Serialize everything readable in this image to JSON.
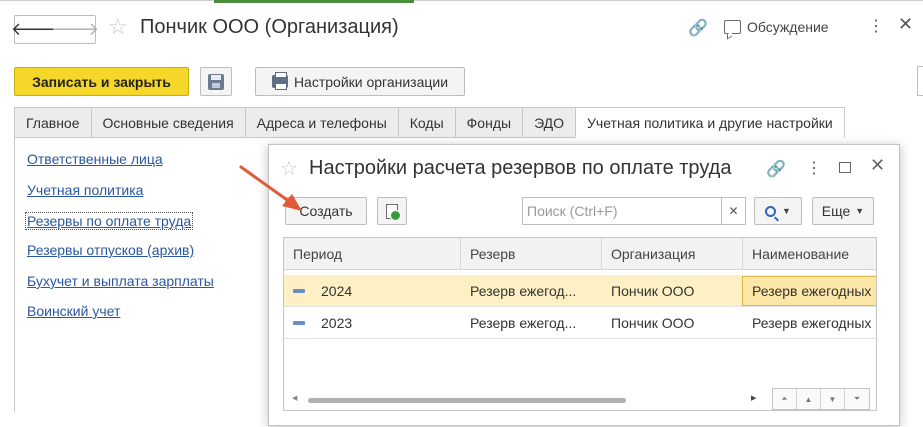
{
  "window": {
    "title": "Пончик ООО (Организация)",
    "discussion_label": "Обсуждение"
  },
  "toolbar": {
    "save_close_label": "Записать и закрыть",
    "org_settings_label": "Настройки организации"
  },
  "tabs": [
    {
      "label": "Главное"
    },
    {
      "label": "Основные сведения"
    },
    {
      "label": "Адреса и телефоны"
    },
    {
      "label": "Коды"
    },
    {
      "label": "Фонды"
    },
    {
      "label": "ЭДО"
    },
    {
      "label": "Учетная политика и другие настройки",
      "active": true
    }
  ],
  "sidebar": {
    "items": [
      {
        "label": "Ответственные лица"
      },
      {
        "label": "Учетная политика"
      },
      {
        "label": "Резервы по оплате труда",
        "active": true
      },
      {
        "label": "Резервы отпусков (архив)"
      },
      {
        "label": "Бухучет и выплата зарплаты"
      },
      {
        "label": "Воинский учет"
      }
    ]
  },
  "modal": {
    "title": "Настройки расчета резервов по оплате труда",
    "create_label": "Создать",
    "search_placeholder": "Поиск (Ctrl+F)",
    "more_label": "Еще",
    "columns": [
      "Период",
      "Резерв",
      "Организация",
      "Наименование"
    ],
    "rows": [
      {
        "period": "2024",
        "reserve": "Резерв ежегод...",
        "org": "Пончик ООО",
        "name": "Резерв ежегодных",
        "selected": true
      },
      {
        "period": "2023",
        "reserve": "Резерв ежегод...",
        "org": "Пончик ООО",
        "name": "Резерв ежегодных",
        "selected": false
      }
    ]
  },
  "icons": {
    "back": "arrow-left-icon",
    "forward": "arrow-right-icon",
    "favorite": "star-icon",
    "link": "link-icon",
    "discussion": "chat-icon",
    "more": "kebab-icon",
    "close": "close-icon",
    "save": "floppy-icon",
    "print": "printer-icon",
    "copy": "copy-doc-icon",
    "search": "search-icon",
    "maximize": "maximize-icon"
  },
  "colors": {
    "primary_button": "#f5d72a",
    "link": "#2a57a0",
    "selected_row": "#fdf0c4",
    "arrow": "#e05a3a"
  }
}
